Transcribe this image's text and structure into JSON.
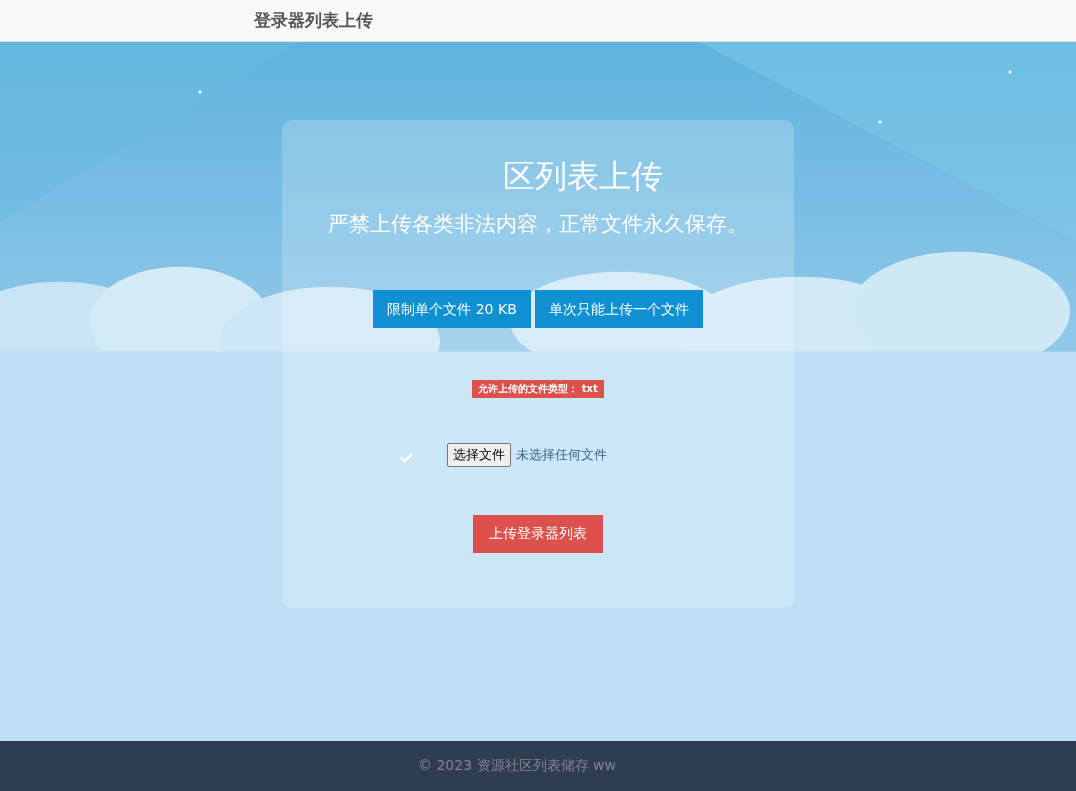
{
  "header": {
    "title": "登录器列表上传"
  },
  "card": {
    "title": "区列表上传",
    "subtitle": "严禁上传各类非法内容，正常文件永久保存。",
    "limits": [
      "限制单个文件 20 KB",
      "单次只能上传一个文件"
    ],
    "allowed_types": "允许上传的文件类型： txt",
    "file_picker": {
      "button": "选择文件",
      "status": "未选择任何文件"
    },
    "submit": "上传登录器列表"
  },
  "footer": {
    "text": "© 2023 资源社区列表储存 ww"
  }
}
